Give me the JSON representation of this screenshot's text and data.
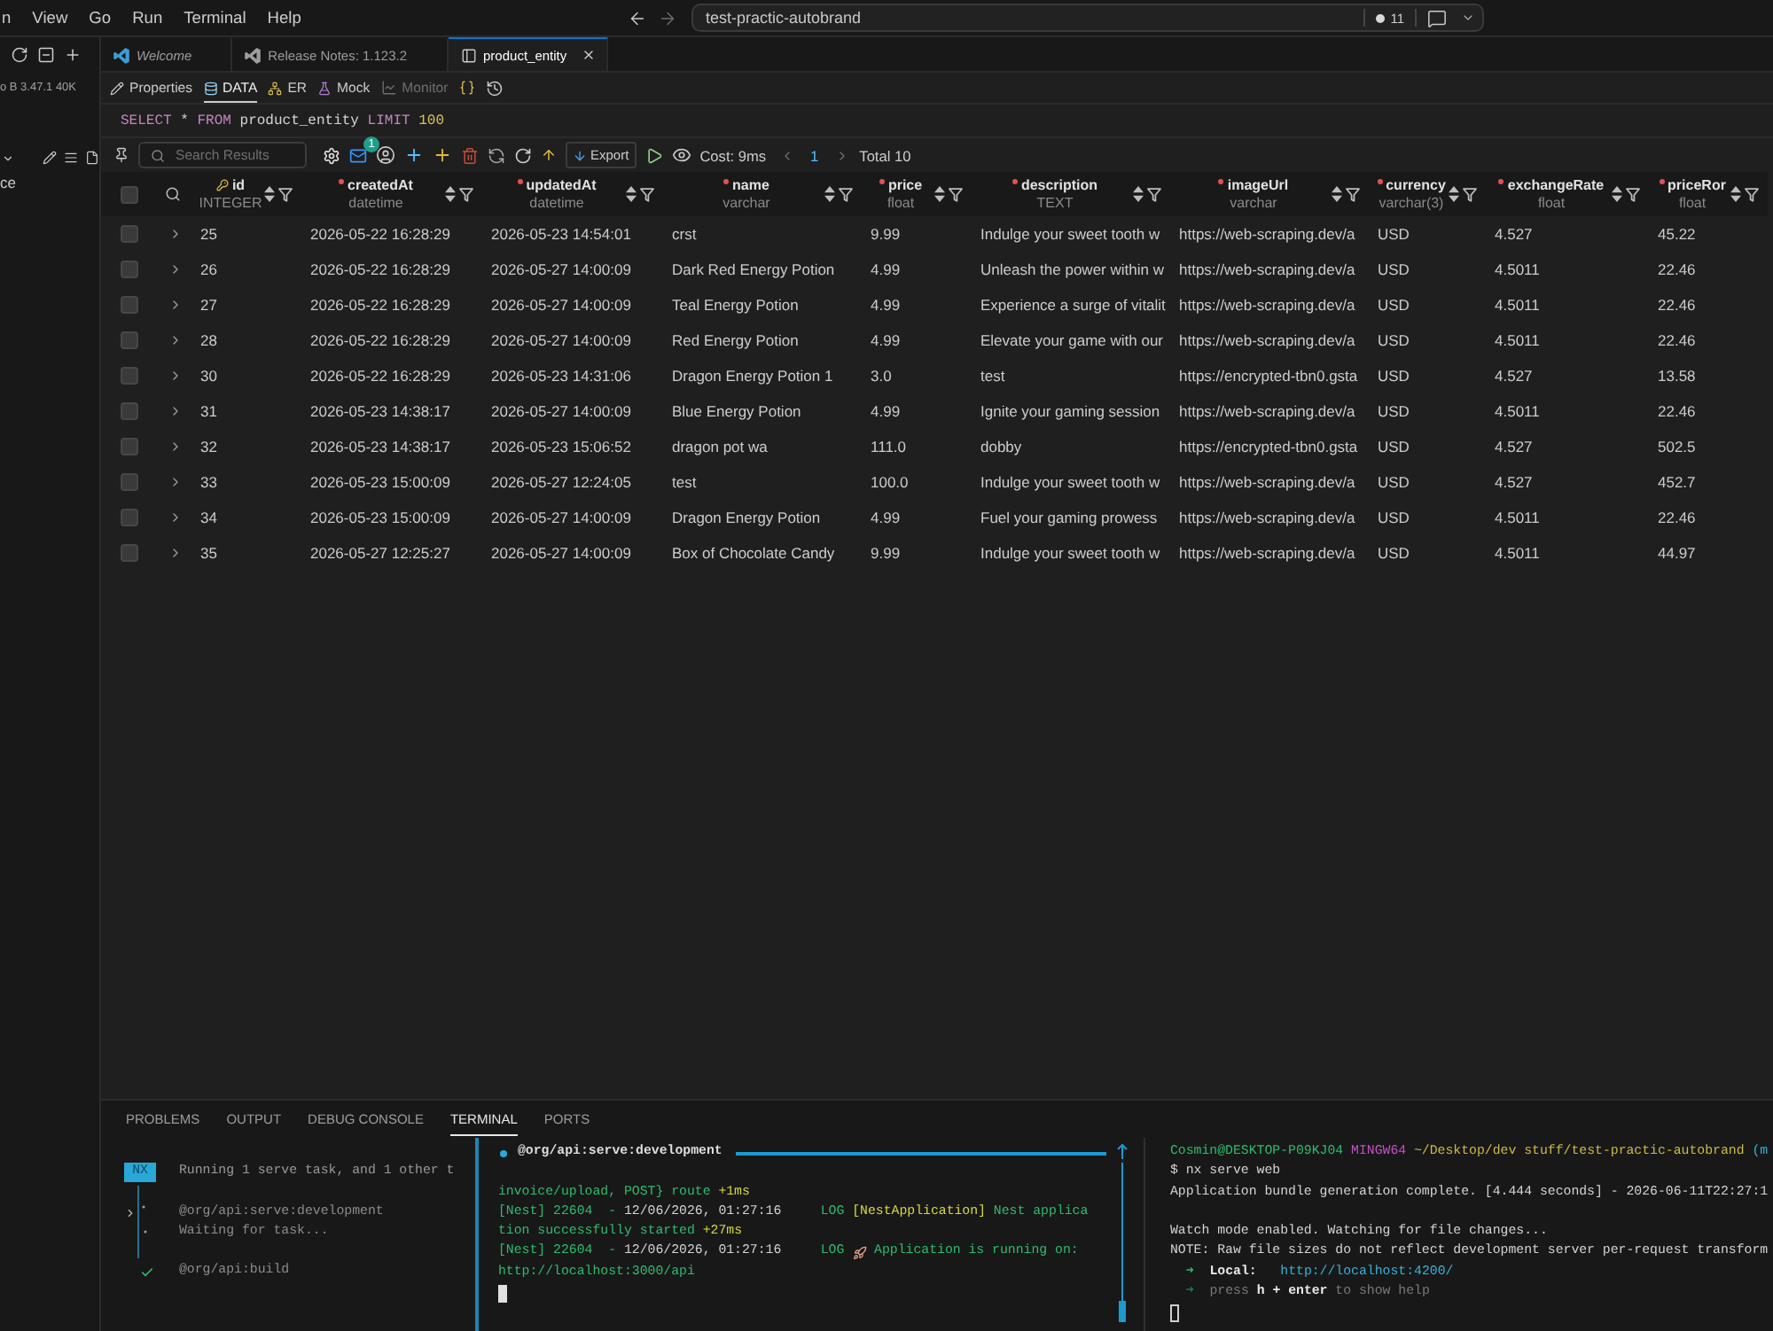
{
  "menu_bar": {
    "items": [
      "n",
      "View",
      "Go",
      "Run",
      "Terminal",
      "Help"
    ]
  },
  "command_center": {
    "title": "test-practic-autobrand",
    "count": "11"
  },
  "sidebar": {
    "status": "o B 3.47.1 40K",
    "tree_item": "ce"
  },
  "editor_tabs": [
    {
      "label": "Welcome",
      "kind": "welcome",
      "preview": true,
      "selected": false
    },
    {
      "label": "Release Notes: 1.123.2",
      "kind": "release",
      "preview": false,
      "selected": false
    },
    {
      "label": "product_entity",
      "kind": "table",
      "preview": false,
      "selected": true
    }
  ],
  "view_tabs": [
    {
      "label": "Properties",
      "kind": "properties",
      "selected": false,
      "disabled": false
    },
    {
      "label": "DATA",
      "kind": "data",
      "selected": true,
      "disabled": false
    },
    {
      "label": "ER",
      "kind": "er",
      "selected": false,
      "disabled": false
    },
    {
      "label": "Mock",
      "kind": "mock",
      "selected": false,
      "disabled": false
    },
    {
      "label": "Monitor",
      "kind": "monitor",
      "selected": false,
      "disabled": true
    }
  ],
  "query": [
    {
      "text": "SELECT",
      "kind": "keyword"
    },
    {
      "text": "*",
      "kind": "plain"
    },
    {
      "text": "FROM",
      "kind": "keyword"
    },
    {
      "text": "product_entity",
      "kind": "plain"
    },
    {
      "text": "LIMIT",
      "kind": "keyword"
    },
    {
      "text": "100",
      "kind": "number"
    }
  ],
  "results_toolbar": {
    "search_placeholder": "Search Results",
    "badge": "1",
    "export": "Export",
    "cost": "Cost: 9ms",
    "page": "1",
    "total": "Total 10"
  },
  "table": {
    "select_all": {
      "checked": false
    },
    "columns": [
      {
        "name": "id",
        "type": "INTEGER",
        "primary_key": true,
        "required": false
      },
      {
        "name": "createdAt",
        "type": "datetime",
        "primary_key": false,
        "required": true
      },
      {
        "name": "updatedAt",
        "type": "datetime",
        "primary_key": false,
        "required": true
      },
      {
        "name": "name",
        "type": "varchar",
        "primary_key": false,
        "required": true
      },
      {
        "name": "price",
        "type": "float",
        "primary_key": false,
        "required": true
      },
      {
        "name": "description",
        "type": "TEXT",
        "primary_key": false,
        "required": true
      },
      {
        "name": "imageUrl",
        "type": "varchar",
        "primary_key": false,
        "required": true
      },
      {
        "name": "currency",
        "type": "varchar(3)",
        "primary_key": false,
        "required": true
      },
      {
        "name": "exchangeRate",
        "type": "float",
        "primary_key": false,
        "required": true
      },
      {
        "name": "priceRor",
        "type": "float",
        "primary_key": false,
        "required": true
      }
    ],
    "rows": [
      {
        "checked": false,
        "expanded": false,
        "cells": [
          "25",
          "2026-05-22 16:28:29",
          "2026-05-23 14:54:01",
          "crst",
          "9.99",
          "Indulge your sweet tooth w",
          "https://web-scraping.dev/a",
          "USD",
          "4.527",
          "45.22"
        ]
      },
      {
        "checked": false,
        "expanded": false,
        "cells": [
          "26",
          "2026-05-22 16:28:29",
          "2026-05-27 14:00:09",
          "Dark Red Energy Potion",
          "4.99",
          "Unleash the power within w",
          "https://web-scraping.dev/a",
          "USD",
          "4.5011",
          "22.46"
        ]
      },
      {
        "checked": false,
        "expanded": false,
        "cells": [
          "27",
          "2026-05-22 16:28:29",
          "2026-05-27 14:00:09",
          "Teal Energy Potion",
          "4.99",
          "Experience a surge of vitalit",
          "https://web-scraping.dev/a",
          "USD",
          "4.5011",
          "22.46"
        ]
      },
      {
        "checked": false,
        "expanded": false,
        "cells": [
          "28",
          "2026-05-22 16:28:29",
          "2026-05-27 14:00:09",
          "Red Energy Potion",
          "4.99",
          "Elevate your game with our",
          "https://web-scraping.dev/a",
          "USD",
          "4.5011",
          "22.46"
        ]
      },
      {
        "checked": false,
        "expanded": false,
        "cells": [
          "30",
          "2026-05-22 16:28:29",
          "2026-05-23 14:31:06",
          "Dragon Energy Potion 1",
          "3.0",
          "test",
          "https://encrypted-tbn0.gsta",
          "USD",
          "4.527",
          "13.58"
        ]
      },
      {
        "checked": false,
        "expanded": false,
        "cells": [
          "31",
          "2026-05-23 14:38:17",
          "2026-05-27 14:00:09",
          "Blue Energy Potion",
          "4.99",
          "Ignite your gaming session",
          "https://web-scraping.dev/a",
          "USD",
          "4.5011",
          "22.46"
        ]
      },
      {
        "checked": false,
        "expanded": false,
        "cells": [
          "32",
          "2026-05-23 14:38:17",
          "2026-05-23 15:06:52",
          "dragon pot wa",
          "111.0",
          "dobby",
          "https://encrypted-tbn0.gsta",
          "USD",
          "4.527",
          "502.5"
        ]
      },
      {
        "checked": false,
        "expanded": false,
        "cells": [
          "33",
          "2026-05-23 15:00:09",
          "2026-05-27 12:24:05",
          "test",
          "100.0",
          "Indulge your sweet tooth w",
          "https://web-scraping.dev/a",
          "USD",
          "4.527",
          "452.7"
        ]
      },
      {
        "checked": false,
        "expanded": false,
        "cells": [
          "34",
          "2026-05-23 15:00:09",
          "2026-05-27 14:00:09",
          "Dragon Energy Potion",
          "4.99",
          "Fuel your gaming prowess",
          "https://web-scraping.dev/a",
          "USD",
          "4.5011",
          "22.46"
        ]
      },
      {
        "checked": false,
        "expanded": false,
        "cells": [
          "35",
          "2026-05-27 12:25:27",
          "2026-05-27 14:00:09",
          "Box of Chocolate Candy",
          "9.99",
          "Indulge your sweet tooth w",
          "https://web-scraping.dev/a",
          "USD",
          "4.5011",
          "44.97"
        ]
      }
    ]
  },
  "panel": {
    "tabs": [
      {
        "label": "PROBLEMS",
        "selected": false
      },
      {
        "label": "OUTPUT",
        "selected": false
      },
      {
        "label": "DEBUG CONSOLE",
        "selected": false
      },
      {
        "label": "TERMINAL",
        "selected": true
      },
      {
        "label": "PORTS",
        "selected": false
      }
    ],
    "terminal": {
      "tasks_pane": {
        "badge": "NX",
        "summary": "Running 1 serve task, and 1 other t",
        "tasks": [
          {
            "name": "@org/api:serve:development",
            "detail": "Waiting for task...",
            "kind": "running",
            "selected": true
          },
          {
            "name": "@org/api:build",
            "kind": "done",
            "selected": false
          }
        ]
      },
      "task_output": {
        "title": "@org/api:serve:development",
        "lines": [
          {
            "kind": "blank"
          },
          {
            "kind": "text",
            "segments": [
              {
                "text": "invoice/upload, POST} route ",
                "kind": "log"
              },
              {
                "text": "+1ms",
                "kind": "highlight"
              }
            ]
          },
          {
            "kind": "text",
            "segments": [
              {
                "text": "[Nest] 22604  - ",
                "kind": "log"
              },
              {
                "text": "12/06/2026, 01:27:16",
                "kind": "plain"
              },
              {
                "text": "     LOG ",
                "kind": "log"
              },
              {
                "text": "[NestApplication]",
                "kind": "highlight"
              },
              {
                "text": " Nest applica",
                "kind": "log"
              }
            ]
          },
          {
            "kind": "text",
            "segments": [
              {
                "text": "tion successfully started ",
                "kind": "log"
              },
              {
                "text": "+27ms",
                "kind": "highlight"
              }
            ]
          },
          {
            "kind": "text",
            "segments": [
              {
                "text": "[Nest] 22604  - ",
                "kind": "log"
              },
              {
                "text": "12/06/2026, 01:27:16",
                "kind": "plain"
              },
              {
                "text": "     LOG ",
                "kind": "log"
              },
              {
                "kind": "rocket"
              },
              {
                "text": " Application is running on:",
                "kind": "log"
              }
            ]
          },
          {
            "kind": "text",
            "segments": [
              {
                "text": "http://localhost:3000/api",
                "kind": "log"
              }
            ]
          },
          {
            "kind": "cursor",
            "focused": true
          }
        ]
      },
      "shell": {
        "lines": [
          {
            "kind": "text",
            "segments": [
              {
                "text": "Cosmin@DESKTOP-P09KJ04 ",
                "kind": "user"
              },
              {
                "text": "MINGW64 ",
                "kind": "host"
              },
              {
                "text": "~/Desktop/dev stuff/test-practic-autobrand ",
                "kind": "path"
              },
              {
                "text": "(m",
                "kind": "branch"
              }
            ]
          },
          {
            "kind": "text",
            "segments": [
              {
                "text": "$ nx serve web",
                "kind": "plain"
              }
            ]
          },
          {
            "kind": "text",
            "segments": [
              {
                "text": "Application bundle generation complete. [4.444 seconds] - 2026-06-11T22:27:1",
                "kind": "plain"
              }
            ]
          },
          {
            "kind": "blank"
          },
          {
            "kind": "text",
            "segments": [
              {
                "text": "Watch mode enabled. Watching for file changes...",
                "kind": "plain"
              }
            ]
          },
          {
            "kind": "text",
            "segments": [
              {
                "text": "NOTE: Raw file sizes do not reflect development server per-request transform",
                "kind": "plain"
              }
            ]
          },
          {
            "kind": "text",
            "segments": [
              {
                "text": "  ➜  ",
                "kind": "arrow"
              },
              {
                "text": "Local:",
                "kind": "strong"
              },
              {
                "text": "   http://localhost:4200/",
                "kind": "link"
              }
            ]
          },
          {
            "kind": "text",
            "segments": [
              {
                "text": "  ➜  ",
                "kind": "faint"
              },
              {
                "text": "press ",
                "kind": "muted"
              },
              {
                "text": "h + enter",
                "kind": "strong"
              },
              {
                "text": " to show help",
                "kind": "muted"
              }
            ]
          },
          {
            "kind": "cursor",
            "focused": false
          }
        ]
      }
    }
  }
}
